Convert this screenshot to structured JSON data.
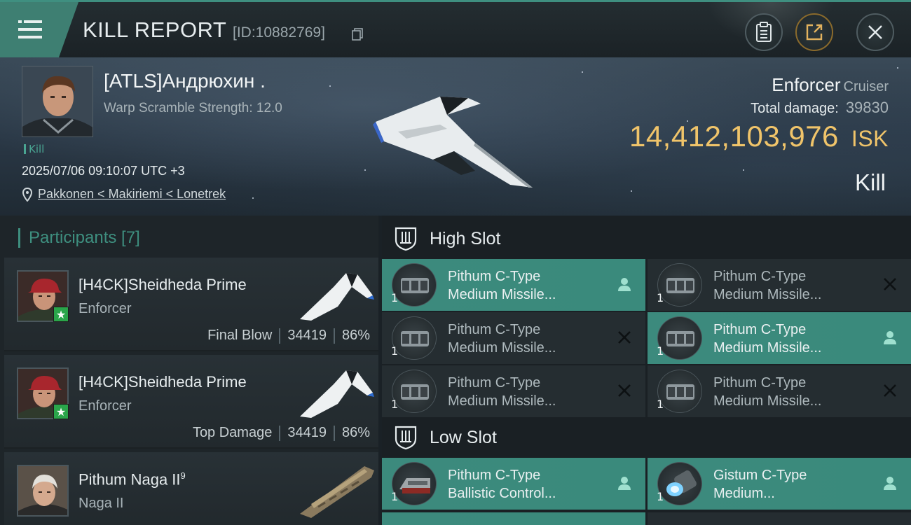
{
  "header": {
    "title": "KILL REPORT",
    "report_id": "[ID:10882769]"
  },
  "icons": {
    "menu": "menu-icon",
    "copy": "copy-icon",
    "clipboard": "clipboard-icon",
    "share": "share-icon",
    "close": "close-icon",
    "location": "location-pin-icon",
    "high_slot": "high-slot-icon",
    "low_slot": "low-slot-icon",
    "pilot": "pilot-icon",
    "destroyed": "x-icon"
  },
  "victim": {
    "name": "[ATLS]Андрюхин .",
    "warp_scramble": "Warp Scramble Strength: 12.0",
    "kill_tag": "Kill",
    "datetime": "2025/07/06 09:10:07 UTC +3",
    "location": "Pakkonen < Makiriemi < Lonetrek",
    "ship_name": "Enforcer",
    "ship_class": "Cruiser",
    "total_damage_label": "Total damage:",
    "total_damage": "39830",
    "isk_value": "14,412,103,976",
    "isk_unit": "ISK",
    "result": "Kill"
  },
  "participants": {
    "header": "Participants [7]",
    "items": [
      {
        "name": "[H4CK]Sheidheda Prime",
        "ship": "Enforcer",
        "role": "Final Blow",
        "damage": "34419",
        "percent": "86%"
      },
      {
        "name": "[H4CK]Sheidheda Prime",
        "ship": "Enforcer",
        "role": "Top Damage",
        "damage": "34419",
        "percent": "86%"
      },
      {
        "name": "Pithum Naga II",
        "name_sup": "9",
        "ship": "Naga II"
      }
    ]
  },
  "slots": {
    "high": {
      "label": "High Slot",
      "modules": [
        {
          "qty": "1",
          "line1": "Pithum C-Type",
          "line2": "Medium Missile...",
          "state": "dropped"
        },
        {
          "qty": "1",
          "line1": "Pithum C-Type",
          "line2": "Medium Missile...",
          "state": "destroyed"
        },
        {
          "qty": "1",
          "line1": "Pithum C-Type",
          "line2": "Medium Missile...",
          "state": "destroyed"
        },
        {
          "qty": "1",
          "line1": "Pithum C-Type",
          "line2": "Medium Missile...",
          "state": "dropped"
        },
        {
          "qty": "1",
          "line1": "Pithum C-Type",
          "line2": "Medium Missile...",
          "state": "destroyed"
        },
        {
          "qty": "1",
          "line1": "Pithum C-Type",
          "line2": "Medium Missile...",
          "state": "destroyed"
        }
      ]
    },
    "low": {
      "label": "Low Slot",
      "modules": [
        {
          "qty": "1",
          "line1": "Pithum C-Type",
          "line2": "Ballistic Control...",
          "state": "dropped"
        },
        {
          "qty": "1",
          "line1": "Gistum C-Type",
          "line2": "Medium...",
          "state": "dropped"
        }
      ]
    }
  },
  "colors": {
    "accent": "#3e8f7f",
    "isk": "#f0c46a",
    "module_active": "#3c8a7d"
  }
}
